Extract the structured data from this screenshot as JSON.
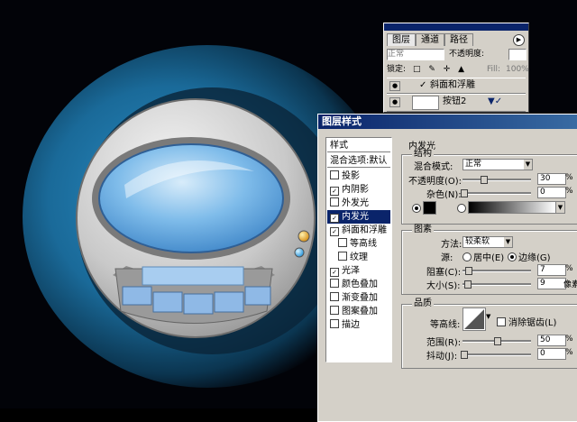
{
  "layers_panel": {
    "tabs": [
      {
        "label": "图层"
      },
      {
        "label": "通道"
      },
      {
        "label": "路径"
      }
    ],
    "menu_icon": "triangle-right-icon",
    "blend_mode": "正常",
    "opacity_label": "不透明度:",
    "lock_label": "锁定:",
    "fill_label": "Fill:",
    "fill_value": "100%",
    "rows": [
      {
        "name": "斜面和浮雕"
      },
      {
        "name": "按钮2"
      }
    ]
  },
  "dialog": {
    "title": "图层样式",
    "styles_header": "样式",
    "blend_options": "混合选项:默认",
    "styles": [
      {
        "label": "投影",
        "checked": false,
        "selected": false
      },
      {
        "label": "内阴影",
        "checked": true,
        "selected": false
      },
      {
        "label": "外发光",
        "checked": false,
        "selected": false
      },
      {
        "label": "内发光",
        "checked": true,
        "selected": true
      },
      {
        "label": "斜面和浮雕",
        "checked": true,
        "selected": false
      },
      {
        "label": "等高线",
        "checked": false,
        "selected": false
      },
      {
        "label": "纹理",
        "checked": false,
        "selected": false
      },
      {
        "label": "光泽",
        "checked": true,
        "selected": false
      },
      {
        "label": "颜色叠加",
        "checked": false,
        "selected": false
      },
      {
        "label": "渐变叠加",
        "checked": false,
        "selected": false
      },
      {
        "label": "图案叠加",
        "checked": false,
        "selected": false
      },
      {
        "label": "描边",
        "checked": false,
        "selected": false
      }
    ],
    "section_title": "内发光",
    "structure": {
      "label": "结构",
      "blend_mode_label": "混合模式:",
      "blend_mode_value": "正常",
      "opacity_label": "不透明度(O):",
      "opacity_value": "30",
      "noise_label": "杂色(N):",
      "noise_value": "0",
      "unit": "%",
      "color": "#000000"
    },
    "elements": {
      "label": "图素",
      "technique_label": "方法:",
      "technique_value": "较柔软",
      "source_label": "源:",
      "source_center": "居中(E)",
      "source_edge": "边缘(G)",
      "choke_label": "阻塞(C):",
      "choke_value": "7",
      "size_label": "大小(S):",
      "size_value": "9",
      "size_unit": "像素",
      "unit": "%"
    },
    "quality": {
      "label": "品质",
      "contour_label": "等高线:",
      "anti_alias_label": "消除锯齿(L)",
      "range_label": "范围(R):",
      "range_value": "50",
      "jitter_label": "抖动(J):",
      "jitter_value": "0",
      "unit": "%"
    }
  },
  "colors": {
    "accent": "#0a246a",
    "glow": "#1e7ab0",
    "screen": "#5aaae8",
    "knob_orange": "#e8a020",
    "knob_blue": "#40b0f0"
  }
}
